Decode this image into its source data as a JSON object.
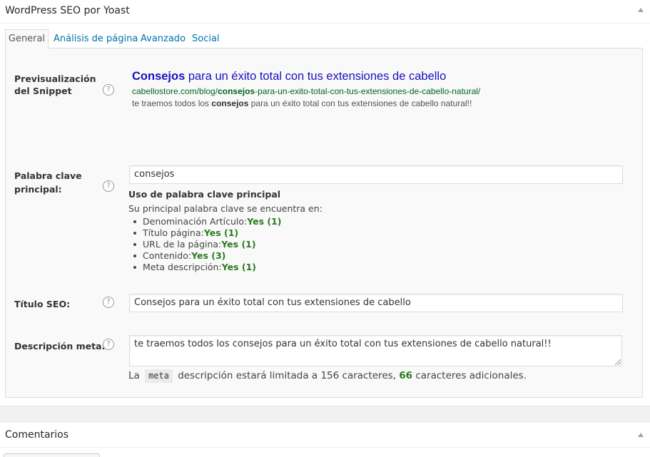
{
  "seo_panel": {
    "title": "WordPress SEO por Yoast",
    "tabs": [
      {
        "label": "General"
      },
      {
        "label": "Análisis de página"
      },
      {
        "label": "Avanzado"
      },
      {
        "label": "Social"
      }
    ],
    "help_glyph": "?",
    "snippet": {
      "label": "Previsualización del Snippet",
      "title_keyword": "Consejos",
      "title_rest": " para un éxito total con tus extensiones de cabello",
      "url_prefix": "cabellostore.com/blog/",
      "url_keyword": "consejos",
      "url_rest": "-para-un-exito-total-con-tus-extensiones-de-cabello-natural/",
      "desc_prefix": "te traemos todos los ",
      "desc_keyword": "consejos",
      "desc_rest": " para un éxito total con tus extensiones de cabello natural!!"
    },
    "focus_keyword": {
      "label": "Palabra clave principal:",
      "value": "consejos",
      "usage_heading": "Uso de palabra clave principal",
      "usage_intro": "Su principal palabra clave se encuentra en:",
      "usage_items": [
        {
          "label": "Denominación Artículo:",
          "result": "Yes (1)"
        },
        {
          "label": "Título página:",
          "result": "Yes (1)"
        },
        {
          "label": "URL de la página:",
          "result": "Yes (1)"
        },
        {
          "label": "Contenido:",
          "result": "Yes (3)"
        },
        {
          "label": "Meta descripción:",
          "result": "Yes (1)"
        }
      ]
    },
    "seo_title": {
      "label": "Título SEO:",
      "value": "Consejos para un éxito total con tus extensiones de cabello"
    },
    "meta_description": {
      "label": "Descripción meta:",
      "value": "te traemos todos los consejos para un éxito total con tus extensiones de cabello natural!!",
      "note_prefix": "La",
      "note_code": "meta",
      "note_mid": "descripción estará limitada a 156 caracteres,",
      "note_count": "66",
      "note_suffix": "caracteres adicionales."
    }
  },
  "comments_panel": {
    "title": "Comentarios"
  },
  "colors": {
    "link": "#0073aa",
    "snippet_title": "#1e0fbe",
    "snippet_url": "#006621",
    "positive": "#2a7a1f"
  }
}
